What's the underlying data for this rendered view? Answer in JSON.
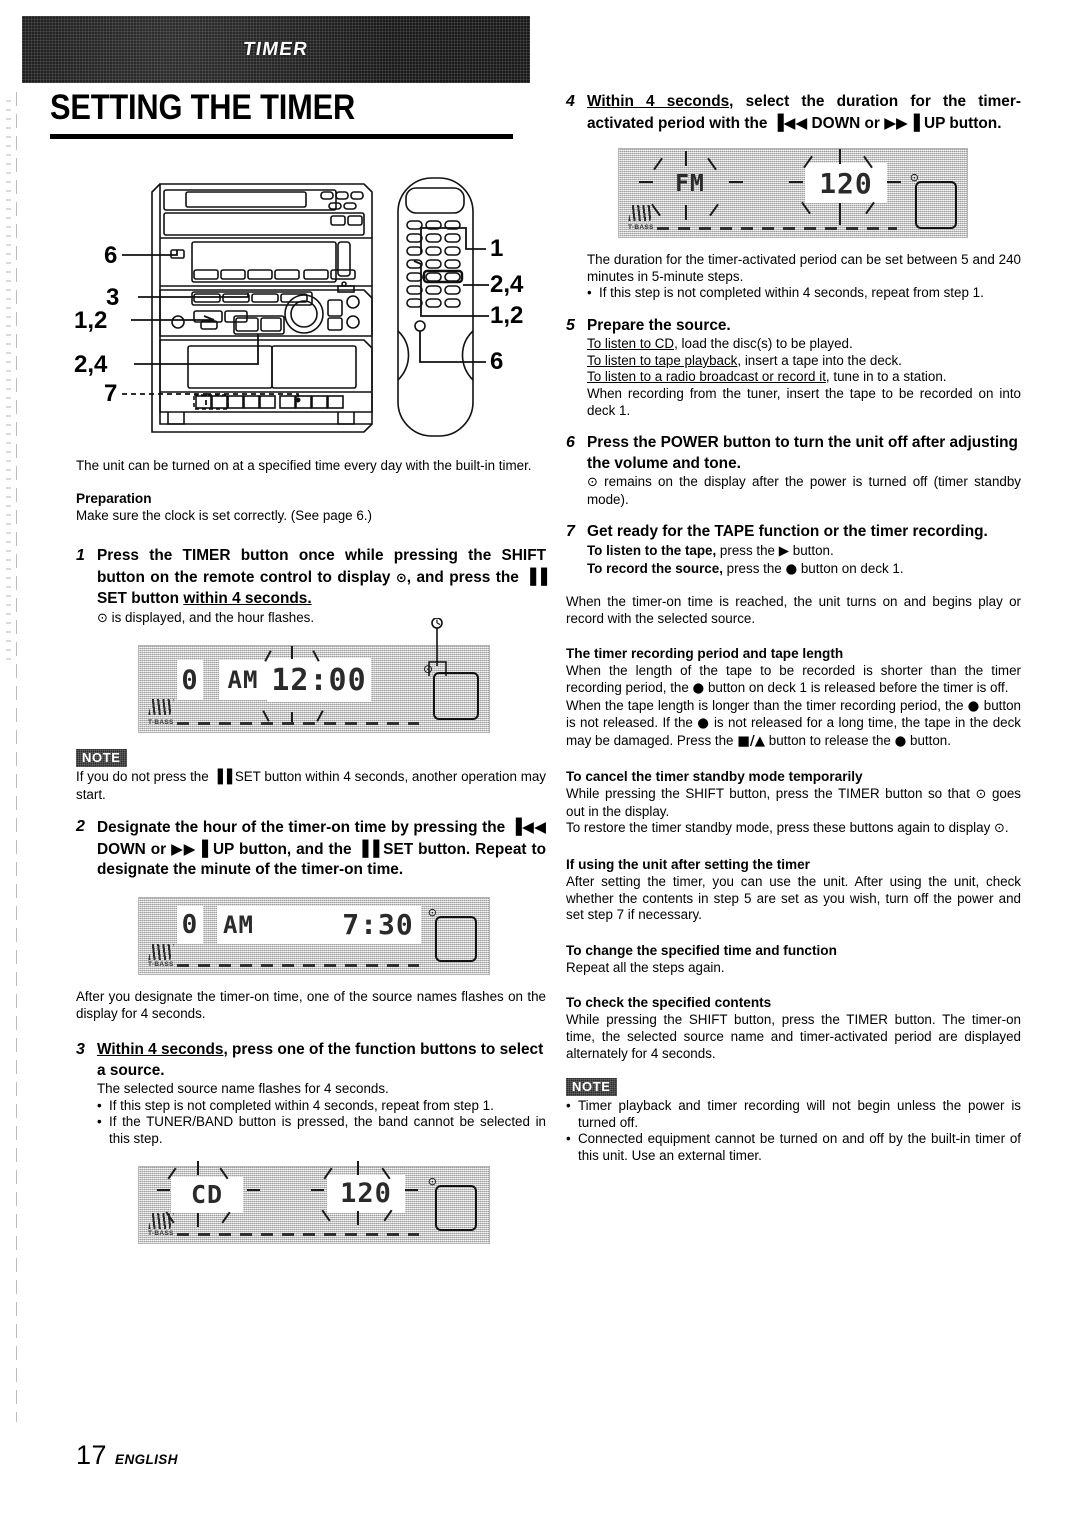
{
  "banner": {
    "label": "TIMER"
  },
  "header": {
    "title": "SETTING THE TIMER"
  },
  "figure": {
    "callouts_left": [
      "6",
      "3",
      "1,2",
      "2,4",
      "7"
    ],
    "callouts_right": [
      "1",
      "2,4",
      "1,2",
      "6"
    ]
  },
  "left": {
    "intro": "The unit can be turned on at a specified time every day with the built-in timer.",
    "preparation_head": "Preparation",
    "preparation_text": "Make sure the clock is set correctly. (See page 6.)",
    "step1": {
      "num": "1",
      "head_a": "Press the TIMER button once while pressing the SHIFT button on the remote control to display ",
      "head_clock": "⊙",
      "head_b": ", and press the ",
      "head_pause": "▐▐",
      "head_c": " SET button ",
      "head_underlined": "within 4 seconds.",
      "sub_clock": "⊙",
      "sub": " is displayed, and the hour flashes."
    },
    "display1": {
      "left_digit": "0",
      "ampm": "AM",
      "time": "12:00",
      "tbass": "T-BASS",
      "timer_icon": "⊙"
    },
    "note1": {
      "badge": "NOTE",
      "text_a": "If you do not press the ",
      "pause": "▐▐",
      "text_b": " SET button within 4 seconds, another operation may start."
    },
    "step2": {
      "num": "2",
      "head_a": "Designate the hour of the timer-on time by pressing the ",
      "down": "▐◀◀",
      "head_b": " DOWN or ",
      "up": "▶▶▐",
      "head_c": " UP button, and the ",
      "pause": "▐▐",
      "head_d": " SET button. Repeat to designate the minute of the timer-on time."
    },
    "display2": {
      "left_digit": "0",
      "ampm": "AM",
      "time": "7:30",
      "tbass": "T-BASS",
      "timer_icon": "⊙"
    },
    "after_step2": "After you designate the timer-on time, one of the source names flashes on the display for 4 seconds.",
    "step3": {
      "num": "3",
      "head_underlined": "Within 4 seconds",
      "head_rest": ", press one of the function buttons to select a source.",
      "sub": "The selected source name flashes for 4 seconds.",
      "bullets": [
        "If this step is not completed within 4 seconds, repeat from step 1.",
        "If the TUNER/BAND button is pressed, the band cannot be selected in this step."
      ]
    },
    "display3": {
      "source": "CD",
      "value": "120",
      "tbass": "T-BASS",
      "timer_icon": "⊙"
    }
  },
  "right": {
    "step4": {
      "num": "4",
      "head_underlined": "Within 4 seconds",
      "head_a": ", select the duration for the timer-activated period with the ",
      "down": "▐◀◀",
      "head_b": " DOWN or ",
      "up": "▶▶▐",
      "head_c": " UP button."
    },
    "display4": {
      "source": "FM",
      "value": "120",
      "tbass": "T-BASS",
      "timer_icon": "⊙"
    },
    "after_step4": "The duration for the timer-activated period can be set between 5 and 240 minutes in 5-minute steps.",
    "after_step4_bullets": [
      "If this step is not completed within 4 seconds, repeat from step 1."
    ],
    "step5": {
      "num": "5",
      "head": "Prepare the source.",
      "lines": [
        {
          "u": "To listen to CD",
          "rest": ", load the disc(s) to be played."
        },
        {
          "u": "To listen to tape playback",
          "rest": ", insert a tape into the deck."
        },
        {
          "u": "To listen to a radio broadcast or record it",
          "rest": ", tune in to a station."
        }
      ],
      "tail": "When recording from the tuner, insert the tape to be recorded on into deck 1."
    },
    "step6": {
      "num": "6",
      "head": "Press the POWER button to turn the unit off after adjusting the volume and tone.",
      "sub_clock": "⊙",
      "sub": " remains on the display after the power is turned off (timer standby mode)."
    },
    "step7": {
      "num": "7",
      "head": "Get ready for the TAPE function or the timer recording.",
      "line1_b": "To listen to the tape,",
      "line1_a": " press the ",
      "line1_glyph": "▶",
      "line1_c": " button.",
      "line2_b": "To record the source,",
      "line2_a": " press the ",
      "line2_glyph": "●",
      "line2_c": " button on deck 1."
    },
    "after_steps": "When the timer-on time is reached, the unit turns on and begins play or record with the selected source.",
    "sec_tape": {
      "head": "The timer recording period and tape length",
      "p1_a": "When the length of the tape to be recorded is shorter than the timer recording period, the ",
      "p1_dot": "●",
      "p1_b": " button on deck 1 is released before the timer is off.",
      "p2_a": "When the tape length is longer than the timer recording period, the ",
      "p2_dot1": "●",
      "p2_b": " button is not released. If the ",
      "p2_dot2": "●",
      "p2_c": " is not released for a long time, the tape in the deck may be damaged. Press the ",
      "p2_stop": "■/▲",
      "p2_d": " button to release the ",
      "p2_dot3": "●",
      "p2_e": " button."
    },
    "sec_cancel": {
      "head": "To cancel the timer standby mode temporarily",
      "p1_a": "While pressing the SHIFT button, press the TIMER button so that ",
      "p1_clock": "⊙",
      "p1_b": " goes out in the display.",
      "p2_a": "To restore the timer standby mode, press these buttons again to display ",
      "p2_clock": "⊙",
      "p2_b": "."
    },
    "sec_using": {
      "head": "If using the unit after setting the timer",
      "text": "After setting the timer, you can use the unit.  After using the unit, check whether the contents in step 5 are set as you wish, turn off the power and set step 7 if necessary."
    },
    "sec_change": {
      "head": "To change the specified time and function",
      "text": "Repeat all the steps again."
    },
    "sec_check": {
      "head": "To check the specified contents",
      "text": "While pressing the SHIFT button, press the TIMER button.  The timer-on time, the selected source name and timer-activated period are displayed alternately for 4 seconds."
    },
    "note2": {
      "badge": "NOTE",
      "bullets": [
        "Timer playback and timer recording will not begin unless the power is turned off.",
        "Connected equipment cannot be turned on and off by the built-in timer of this unit. Use an external timer."
      ]
    }
  },
  "footer": {
    "page": "17",
    "language": "ENGLISH"
  }
}
